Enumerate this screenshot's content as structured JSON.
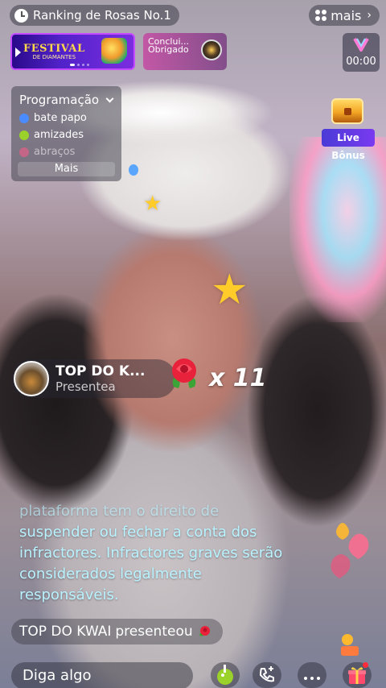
{
  "top_bar": {
    "ranking_label": "Ranking de Rosas No.1",
    "more_label": "mais"
  },
  "festival_banner": {
    "title": "FESTIVAL",
    "subtitle": "DE DIAMANTES"
  },
  "concluded_card": {
    "line1": "Conclui...",
    "line2": "Obrigado"
  },
  "timer": {
    "value": "00:00"
  },
  "schedule": {
    "title": "Programação",
    "items": [
      {
        "label": "bate papo",
        "color": "#4a8cff"
      },
      {
        "label": "amizades",
        "color": "#9ad12a"
      },
      {
        "label": "abraços",
        "color": "#ff5a8a"
      }
    ],
    "more_label": "Mais"
  },
  "live_bonus": {
    "label": "Live Bônus"
  },
  "gift_notice": {
    "username": "TOP DO K...",
    "action": "Presentea",
    "count": "x 11"
  },
  "rules_text": {
    "lines": [
      "plataforma tem o direito de",
      "suspender ou fechar a conta dos",
      "infractores. Infractores graves serão",
      "considerados legalmente",
      "responsáveis."
    ]
  },
  "comment": {
    "username": "TOP DO KWAI",
    "action": "presenteou"
  },
  "bottom_bar": {
    "input_placeholder": "Diga algo"
  },
  "colors": {
    "rules_text": "#b9f3ff",
    "festival_border": "#c54bff",
    "bonus_label": "#5a3be0"
  }
}
